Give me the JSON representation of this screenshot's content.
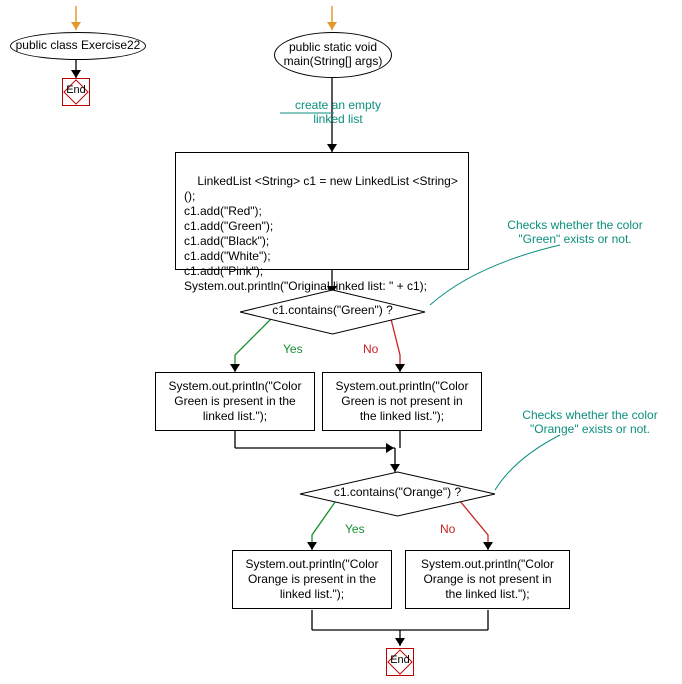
{
  "flowchart": {
    "class_start_label": "public class Exercise22",
    "end_label": "End",
    "main_start_label": "public static void\nmain(String[] args)",
    "comment_create_list": "create an empty\nlinked list",
    "process_init": "LinkedList <String> c1 = new LinkedList <String> ();\nc1.add(\"Red\");\nc1.add(\"Green\");\nc1.add(\"Black\");\nc1.add(\"White\");\nc1.add(\"Pink\");\nSystem.out.println(\"Original linked list: \" + c1);",
    "decision_green": "c1.contains(\"Green\") ?",
    "comment_check_green": "Checks whether the color\n\"Green\" exists or not.",
    "yes_label": "Yes",
    "no_label": "No",
    "process_green_yes": "System.out.println(\"Color\nGreen is present in the\nlinked list.\");",
    "process_green_no": "System.out.println(\"Color\nGreen is not present in\nthe linked list.\");",
    "decision_orange": "c1.contains(\"Orange\") ?",
    "comment_check_orange": "Checks whether the color\n\"Orange\" exists or not.",
    "process_orange_yes": "System.out.println(\"Color\nOrange is present in the\nlinked list.\");",
    "process_orange_no": "System.out.println(\"Color\nOrange is not present in\nthe linked list.\");"
  }
}
